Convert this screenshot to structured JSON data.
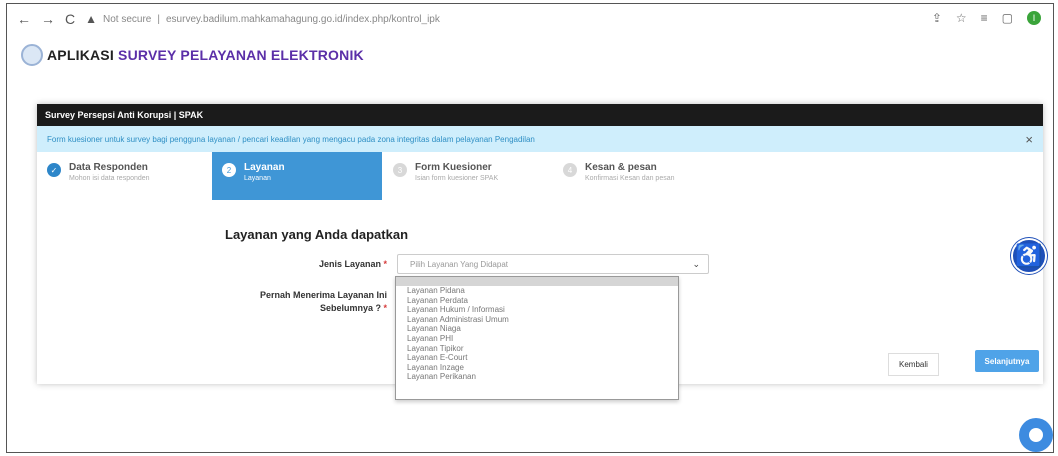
{
  "browser": {
    "back": "←",
    "forward": "→",
    "reload": "C",
    "security": "Not secure",
    "url": "esurvey.badilum.mahkamahagung.go.id/index.php/kontrol_ipk",
    "profile_initial": "I"
  },
  "app": {
    "title_prefix": "APLIKASI",
    "title_accent": "SURVEY PELAYANAN ELEKTRONIK"
  },
  "panel": {
    "title": "Survey Persepsi Anti Korupsi | SPAK",
    "alert": "Form kuesioner untuk survey bagi pengguna layanan / pencari keadilan yang mengacu pada zona integritas dalam pelayanan Pengadilan",
    "close": "×"
  },
  "steps": [
    {
      "title": "Data Responden",
      "subtitle": "Mohon isi data responden",
      "num": "✓"
    },
    {
      "title": "Layanan",
      "subtitle": "Layanan",
      "num": "2"
    },
    {
      "title": "Form Kuesioner",
      "subtitle": "Isian form kuesioner SPAK",
      "num": "3"
    },
    {
      "title": "Kesan & pesan",
      "subtitle": "Konfirmasi Kesan dan pesan",
      "num": "4"
    }
  ],
  "form": {
    "section_title": "Layanan yang Anda dapatkan",
    "jenis_label": "Jenis Layanan",
    "select_placeholder": "Pilih Layanan Yang Didapat",
    "pernah_label_1": "Pernah Menerima Layanan Ini",
    "pernah_label_2": "Sebelumnya ?",
    "required": "*"
  },
  "dropdown": {
    "options": [
      "Layanan Pidana",
      "Layanan Perdata",
      "Layanan Hukum / Informasi",
      "Layanan Administrasi Umum",
      "Layanan Niaga",
      "Layanan PHI",
      "Layanan Tipikor",
      "Layanan E-Court",
      "Layanan Inzage",
      "Layanan Perikanan"
    ]
  },
  "buttons": {
    "back": "Kembali",
    "next": "Selanjutnya"
  },
  "colors": {
    "accent": "#5b2fa8",
    "active_step": "#3f96d6",
    "alert_bg": "#cfeefc",
    "a11y": "#1e4fb8"
  }
}
